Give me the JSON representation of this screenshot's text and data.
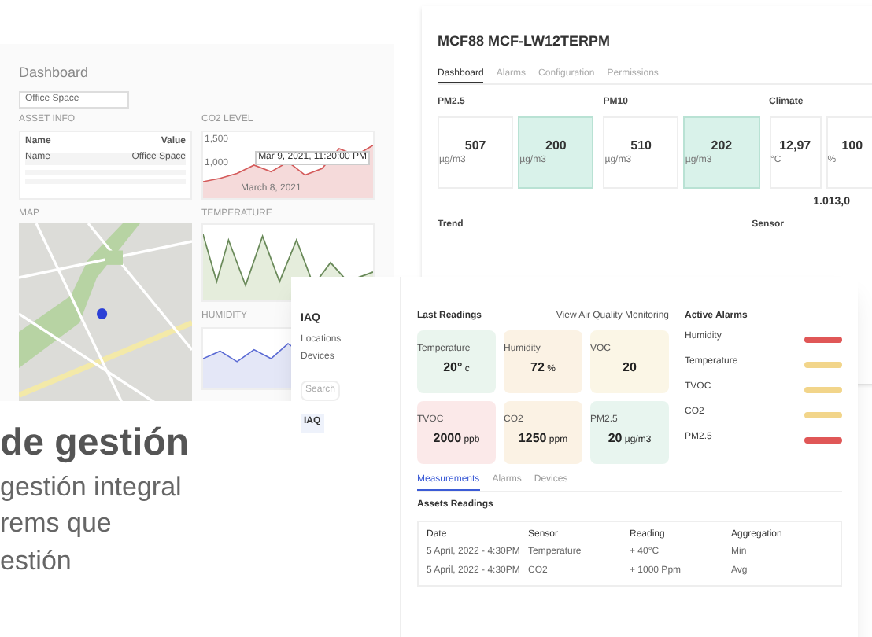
{
  "dashboard": {
    "title": "Dashboard",
    "site_select": "Office Space",
    "panels": [
      "ASSET INFO",
      "CO2 LEVEL",
      "MAP",
      "TEMPERATURE",
      "HUMIDITY"
    ],
    "asset_columns": [
      "Name",
      "Value"
    ],
    "asset_rows": [
      [
        "Name",
        "Office Space"
      ]
    ],
    "co2_tooltip": "Mar 9, 2021, 11:20:00 PM",
    "co2_ticks": [
      "1,500",
      "1,000"
    ],
    "date_label": "March 8, 2021"
  },
  "device": {
    "title": "MCF88 MCF-LW12TERPM",
    "tabs": [
      {
        "label": "Dashboard",
        "selected": true
      },
      {
        "label": "Alarms",
        "selected": false
      },
      {
        "label": "Configuration",
        "selected": false
      },
      {
        "label": "Permissions",
        "selected": false
      }
    ],
    "sections": [
      {
        "title": "PM2.5",
        "cards": [
          {
            "value": "507",
            "unit": "µg/m3",
            "highlight": false
          },
          {
            "value": "200",
            "unit": "µg/m3",
            "highlight": true
          }
        ]
      },
      {
        "title": "PM10",
        "cards": [
          {
            "value": "510",
            "unit": "µg/m3",
            "highlight": false
          },
          {
            "value": "202",
            "unit": "µg/m3",
            "highlight": true
          }
        ]
      },
      {
        "title": "Climate",
        "cards": [
          {
            "value": "12,97",
            "unit": "°C",
            "highlight": false
          },
          {
            "value": "100",
            "unit": "%",
            "highlight": false
          }
        ]
      }
    ],
    "pressure": "1.013,0",
    "trend": "Trend",
    "sensor": "Sensor"
  },
  "front": {
    "sidebar": {
      "title": "IAQ",
      "items": [
        "Locations",
        "Devices"
      ],
      "search": "Search",
      "nav": [
        {
          "label": "IAQ",
          "selected": true
        }
      ]
    },
    "readings_title": "Last Readings",
    "readings_link": "View Air Quality Monitoring",
    "readings": [
      {
        "name": "Temperature",
        "value": "20°",
        "unit": "c",
        "color": "#eaf5ee"
      },
      {
        "name": "Humidity",
        "value": "72",
        "unit": "%",
        "color": "#fbf2e4"
      },
      {
        "name": "VOC",
        "value": "20",
        "color": "#fbf6e6"
      },
      {
        "name": "TVOC",
        "value": "2000",
        "unit": "ppb",
        "color": "#fbe9e9"
      },
      {
        "name": "CO2",
        "value": "1250",
        "unit": "ppm",
        "color": "#fbf2e4"
      },
      {
        "name": "PM2.5",
        "value": "20",
        "unit": "µg/m3",
        "color": "#e8f5ef"
      }
    ],
    "alarms_title": "Active Alarms",
    "alarms": [
      {
        "sensor": "Humidity",
        "color": "#e05757"
      },
      {
        "sensor": "Temperature",
        "color": "#f2d58a"
      },
      {
        "sensor": "TVOC",
        "color": "#f2d58a"
      },
      {
        "sensor": "CO2",
        "color": "#f2d58a"
      },
      {
        "sensor": "PM2.5",
        "color": "#e05757"
      }
    ],
    "tabs": [
      {
        "label": "Measurements",
        "selected": true
      },
      {
        "label": "Alarms",
        "selected": false
      },
      {
        "label": "Devices",
        "selected": false
      }
    ],
    "table_title": "Assets Readings",
    "columns": [
      "Date",
      "Sensor",
      "Reading",
      "Aggregation"
    ],
    "rows": [
      [
        "5 April, 2022 - 4:30PM",
        "Temperature",
        "+ 40°C",
        "Min"
      ],
      [
        "5 April, 2022 - 4:30PM",
        "CO2",
        "+ 1000 Ppm",
        "Avg"
      ]
    ]
  },
  "promo": {
    "heading": "de gestión",
    "lines": [
      "gestión integral",
      "rems que",
      "estión"
    ]
  }
}
